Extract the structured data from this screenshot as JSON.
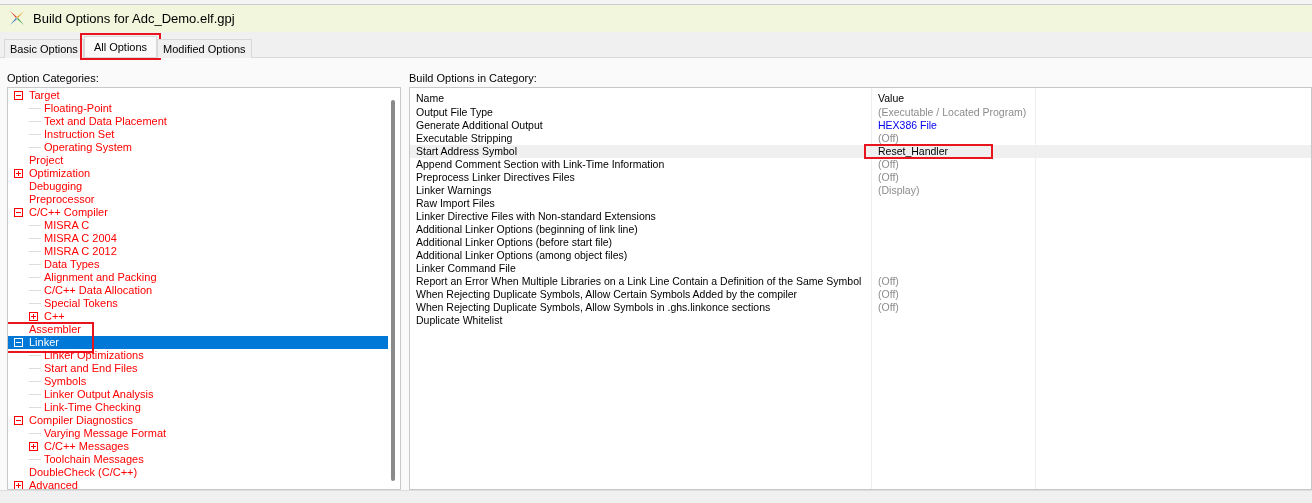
{
  "window": {
    "title": "Build Options for Adc_Demo.elf.gpj"
  },
  "tabs": [
    {
      "label": "Basic Options",
      "selected": false,
      "highlighted": false
    },
    {
      "label": "All Options",
      "selected": true,
      "highlighted": true
    },
    {
      "label": "Modified Options",
      "selected": false,
      "highlighted": false
    }
  ],
  "categories": {
    "label": "Option Categories:",
    "items": [
      {
        "label": "Target",
        "expanded": true,
        "selected": false,
        "highlighted": false,
        "children": [
          {
            "label": "Floating-Point",
            "selected": false,
            "highlighted": false
          },
          {
            "label": "Text and Data Placement",
            "selected": false,
            "highlighted": false
          },
          {
            "label": "Instruction Set",
            "selected": false,
            "highlighted": false
          },
          {
            "label": "Operating System",
            "selected": false,
            "highlighted": false
          }
        ]
      },
      {
        "label": "Project",
        "selected": false,
        "highlighted": false
      },
      {
        "label": "Optimization",
        "expanded": false,
        "selected": false,
        "highlighted": false
      },
      {
        "label": "Debugging",
        "selected": false,
        "highlighted": false
      },
      {
        "label": "Preprocessor",
        "selected": false,
        "highlighted": false
      },
      {
        "label": "C/C++ Compiler",
        "expanded": true,
        "selected": false,
        "highlighted": false,
        "children": [
          {
            "label": "MISRA C",
            "selected": false,
            "highlighted": false
          },
          {
            "label": "MISRA C 2004",
            "selected": false,
            "highlighted": false
          },
          {
            "label": "MISRA C 2012",
            "selected": false,
            "highlighted": false
          },
          {
            "label": "Data Types",
            "selected": false,
            "highlighted": false
          },
          {
            "label": "Alignment and Packing",
            "selected": false,
            "highlighted": false
          },
          {
            "label": "C/C++ Data Allocation",
            "selected": false,
            "highlighted": false
          },
          {
            "label": "Special Tokens",
            "selected": false,
            "highlighted": false
          },
          {
            "label": "C++",
            "expanded": false,
            "selected": false,
            "highlighted": false
          }
        ]
      },
      {
        "label": "Assembler",
        "selected": false,
        "highlighted": false
      },
      {
        "label": "Linker",
        "expanded": true,
        "selected": true,
        "highlighted": true,
        "children": [
          {
            "label": "Linker Optimizations",
            "selected": false,
            "highlighted": false
          },
          {
            "label": "Start and End Files",
            "selected": false,
            "highlighted": false
          },
          {
            "label": "Symbols",
            "selected": false,
            "highlighted": false
          },
          {
            "label": "Linker Output Analysis",
            "selected": false,
            "highlighted": false
          },
          {
            "label": "Link-Time Checking",
            "selected": false,
            "highlighted": false
          }
        ]
      },
      {
        "label": "Compiler Diagnostics",
        "expanded": true,
        "selected": false,
        "highlighted": false,
        "children": [
          {
            "label": "Varying Message Format",
            "selected": false,
            "highlighted": false
          },
          {
            "label": "C/C++ Messages",
            "expanded": false,
            "selected": false,
            "highlighted": false
          },
          {
            "label": "Toolchain Messages",
            "selected": false,
            "highlighted": false
          }
        ]
      },
      {
        "label": "DoubleCheck (C/C++)",
        "selected": false,
        "highlighted": false
      },
      {
        "label": "Advanced",
        "expanded": false,
        "selected": false,
        "highlighted": false
      }
    ]
  },
  "options": {
    "label": "Build Options in Category:",
    "columns": [
      "Name",
      "Value"
    ],
    "rows": [
      {
        "name": "Output File Type",
        "value": "(Executable / Located Program)",
        "kind": "default",
        "selected": false,
        "highlighted": false
      },
      {
        "name": "Generate Additional Output",
        "value": "HEX386 File",
        "kind": "modified",
        "selected": false,
        "highlighted": false
      },
      {
        "name": "Executable Stripping",
        "value": "(Off)",
        "kind": "default",
        "selected": false,
        "highlighted": false
      },
      {
        "name": "Start Address Symbol",
        "value": "Reset_Handler",
        "kind": "set",
        "selected": true,
        "highlighted": true
      },
      {
        "name": "Append Comment Section with Link-Time Information",
        "value": "(Off)",
        "kind": "default",
        "selected": false,
        "highlighted": false
      },
      {
        "name": "Preprocess Linker Directives Files",
        "value": "(Off)",
        "kind": "default",
        "selected": false,
        "highlighted": false
      },
      {
        "name": "Linker Warnings",
        "value": "(Display)",
        "kind": "default",
        "selected": false,
        "highlighted": false
      },
      {
        "name": "Raw Import Files",
        "selected": false,
        "highlighted": false
      },
      {
        "name": "Linker Directive Files with Non-standard Extensions",
        "selected": false,
        "highlighted": false
      },
      {
        "name": "Additional Linker Options (beginning of link line)",
        "selected": false,
        "highlighted": false
      },
      {
        "name": "Additional Linker Options (before start file)",
        "selected": false,
        "highlighted": false
      },
      {
        "name": "Additional Linker Options (among object files)",
        "selected": false,
        "highlighted": false
      },
      {
        "name": "Linker Command File",
        "selected": false,
        "highlighted": false
      },
      {
        "name": "Report an Error When Multiple Libraries on a Link Line Contain a Definition of the Same Symbol",
        "value": "(Off)",
        "kind": "default",
        "selected": false,
        "highlighted": false
      },
      {
        "name": "When Rejecting Duplicate Symbols, Allow Certain Symbols Added by the compiler",
        "value": "(Off)",
        "kind": "default",
        "selected": false,
        "highlighted": false
      },
      {
        "name": "When Rejecting Duplicate Symbols, Allow Symbols in .ghs.linkonce sections",
        "value": "(Off)",
        "kind": "default",
        "selected": false,
        "highlighted": false
      },
      {
        "name": "Duplicate Whitelist",
        "selected": false,
        "highlighted": false
      }
    ]
  }
}
